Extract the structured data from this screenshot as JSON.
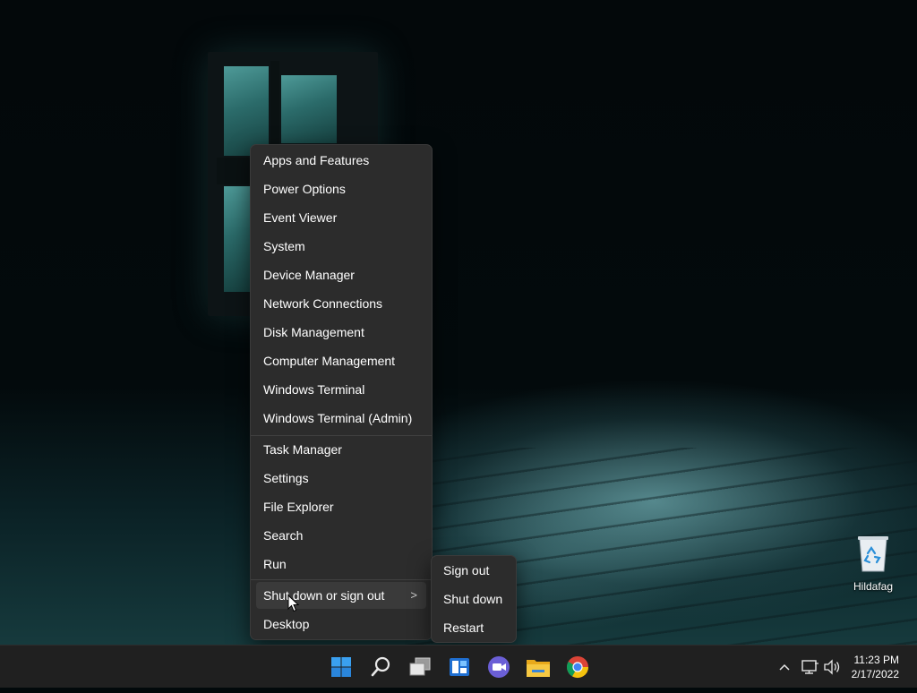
{
  "menu": {
    "items_group1": [
      {
        "label": "Apps and Features"
      },
      {
        "label": "Power Options"
      },
      {
        "label": "Event Viewer"
      },
      {
        "label": "System"
      },
      {
        "label": "Device Manager"
      },
      {
        "label": "Network Connections"
      },
      {
        "label": "Disk Management"
      },
      {
        "label": "Computer Management"
      },
      {
        "label": "Windows Terminal"
      },
      {
        "label": "Windows Terminal (Admin)"
      }
    ],
    "items_group2": [
      {
        "label": "Task Manager"
      },
      {
        "label": "Settings"
      },
      {
        "label": "File Explorer"
      },
      {
        "label": "Search"
      },
      {
        "label": "Run"
      },
      {
        "label": "Shut down or sign out",
        "has_submenu": true,
        "chevron": ">"
      },
      {
        "label": "Desktop"
      }
    ]
  },
  "submenu": {
    "items": [
      {
        "label": "Sign out"
      },
      {
        "label": "Shut down"
      },
      {
        "label": "Restart"
      }
    ]
  },
  "desktop": {
    "icons": [
      {
        "label": "Hildafag",
        "icon": "recycle-bin-icon"
      }
    ]
  },
  "taskbar": {
    "apps": [
      "start-icon",
      "search-icon",
      "task-view-icon",
      "widgets-icon",
      "chat-icon",
      "file-explorer-icon",
      "chrome-icon"
    ],
    "tray_icons": [
      "chevron-up-icon",
      "network-icon",
      "volume-icon"
    ],
    "time": "11:23 PM",
    "date": "2/17/2022"
  },
  "colors": {
    "menu_bg": "#2c2c2c",
    "taskbar_bg": "#202020",
    "start_blue": "#2f8fe6"
  }
}
